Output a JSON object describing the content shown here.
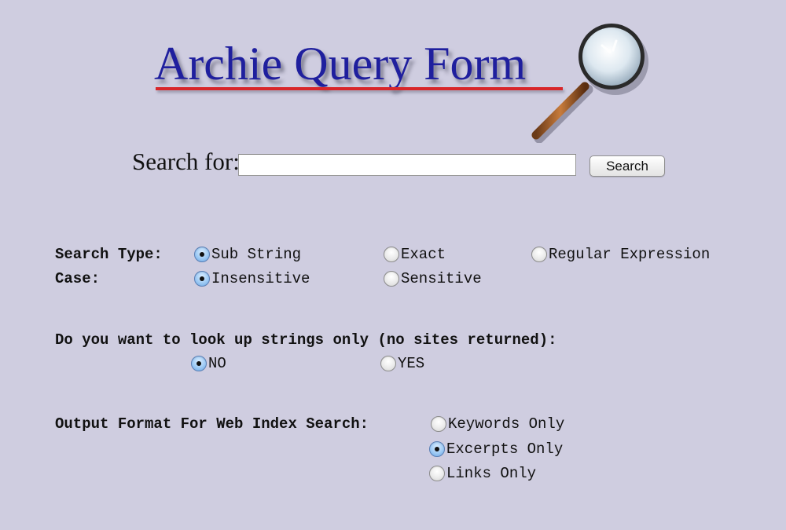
{
  "header": {
    "title": "Archie Query Form",
    "logo_icon": "magnifying-glass-icon",
    "title_color": "#1f1f9e",
    "underline_color": "#d8262a"
  },
  "search": {
    "label": "Search for:",
    "value": "",
    "placeholder": "",
    "button_label": "Search"
  },
  "search_type": {
    "label": "Search Type:",
    "options": [
      {
        "label": "Sub String",
        "selected": true
      },
      {
        "label": "Exact",
        "selected": false
      },
      {
        "label": "Regular Expression",
        "selected": false
      }
    ]
  },
  "case": {
    "label": "Case:",
    "options": [
      {
        "label": "Insensitive",
        "selected": true
      },
      {
        "label": "Sensitive",
        "selected": false
      }
    ]
  },
  "strings_only": {
    "label": "Do you want to look up strings only (no sites returned):",
    "options": [
      {
        "label": "NO",
        "selected": true
      },
      {
        "label": "YES",
        "selected": false
      }
    ]
  },
  "output_format": {
    "label": "Output Format For Web Index Search:",
    "options": [
      {
        "label": "Keywords Only",
        "selected": false
      },
      {
        "label": "Excerpts Only",
        "selected": true
      },
      {
        "label": "Links Only",
        "selected": false
      }
    ]
  },
  "colors": {
    "background": "#cfcde0",
    "radio_selected": "#9ecaf4"
  }
}
